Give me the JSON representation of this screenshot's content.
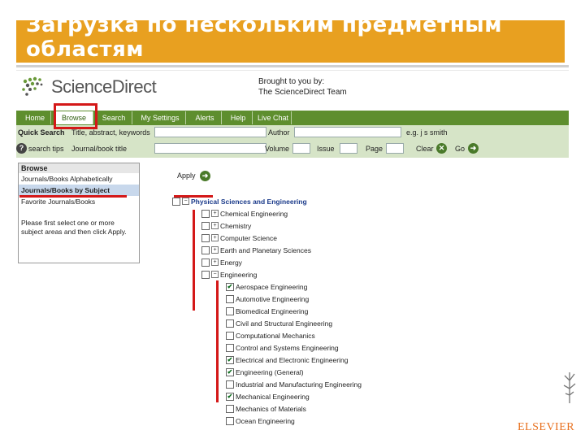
{
  "slide": {
    "title": "Загрузка по нескольким предметным областям"
  },
  "header": {
    "logo_text": "ScienceDirect",
    "brought_line1": "Brought to you by:",
    "brought_line2": "The ScienceDirect Team"
  },
  "nav": {
    "tabs": [
      "Home",
      "Browse",
      "Search",
      "My Settings",
      "Alerts",
      "Help",
      "Live Chat"
    ],
    "active": "Browse"
  },
  "quick_search": {
    "label": "Quick Search",
    "field1_label": "Title, abstract, keywords",
    "author_label": "Author",
    "author_hint": "e.g. j s smith",
    "search_tips": "search tips",
    "field2_label": "Journal/book title",
    "volume_label": "Volume",
    "issue_label": "Issue",
    "page_label": "Page",
    "clear_label": "Clear",
    "go_label": "Go"
  },
  "browse_panel": {
    "title": "Browse",
    "items": [
      "Journals/Books Alphabetically",
      "Journals/Books by Subject",
      "Favorite Journals/Books"
    ],
    "selected_index": 1,
    "note": "Please first select one or more subject areas and then click Apply."
  },
  "apply_label": "Apply",
  "tree": [
    {
      "label": "Physical Sciences and Engineering",
      "level": 0,
      "checked": false,
      "toggle": "−",
      "bold": true
    },
    {
      "label": "Chemical Engineering",
      "level": 1,
      "checked": false,
      "toggle": "+"
    },
    {
      "label": "Chemistry",
      "level": 1,
      "checked": false,
      "toggle": "+"
    },
    {
      "label": "Computer Science",
      "level": 1,
      "checked": false,
      "toggle": "+"
    },
    {
      "label": "Earth and Planetary Sciences",
      "level": 1,
      "checked": false,
      "toggle": "+"
    },
    {
      "label": "Energy",
      "level": 1,
      "checked": false,
      "toggle": "+"
    },
    {
      "label": "Engineering",
      "level": 1,
      "checked": false,
      "toggle": "−"
    },
    {
      "label": "Aerospace Engineering",
      "level": 2,
      "checked": true
    },
    {
      "label": "Automotive Engineering",
      "level": 2,
      "checked": false
    },
    {
      "label": "Biomedical Engineering",
      "level": 2,
      "checked": false
    },
    {
      "label": "Civil and Structural Engineering",
      "level": 2,
      "checked": false
    },
    {
      "label": "Computational Mechanics",
      "level": 2,
      "checked": false
    },
    {
      "label": "Control and Systems Engineering",
      "level": 2,
      "checked": false
    },
    {
      "label": "Electrical and Electronic Engineering",
      "level": 2,
      "checked": true
    },
    {
      "label": "Engineering (General)",
      "level": 2,
      "checked": true
    },
    {
      "label": "Industrial and Manufacturing Engineering",
      "level": 2,
      "checked": false
    },
    {
      "label": "Mechanical Engineering",
      "level": 2,
      "checked": true
    },
    {
      "label": "Mechanics of Materials",
      "level": 2,
      "checked": false
    },
    {
      "label": "Ocean Engineering",
      "level": 2,
      "checked": false
    }
  ],
  "footer": {
    "publisher": "ELSEVIER"
  },
  "colors": {
    "title_bg": "#e8a020",
    "nav_bg": "#5e8e2e",
    "qs_bg": "#d6e4c7",
    "highlight": "#d41818",
    "publisher": "#e8701e"
  }
}
